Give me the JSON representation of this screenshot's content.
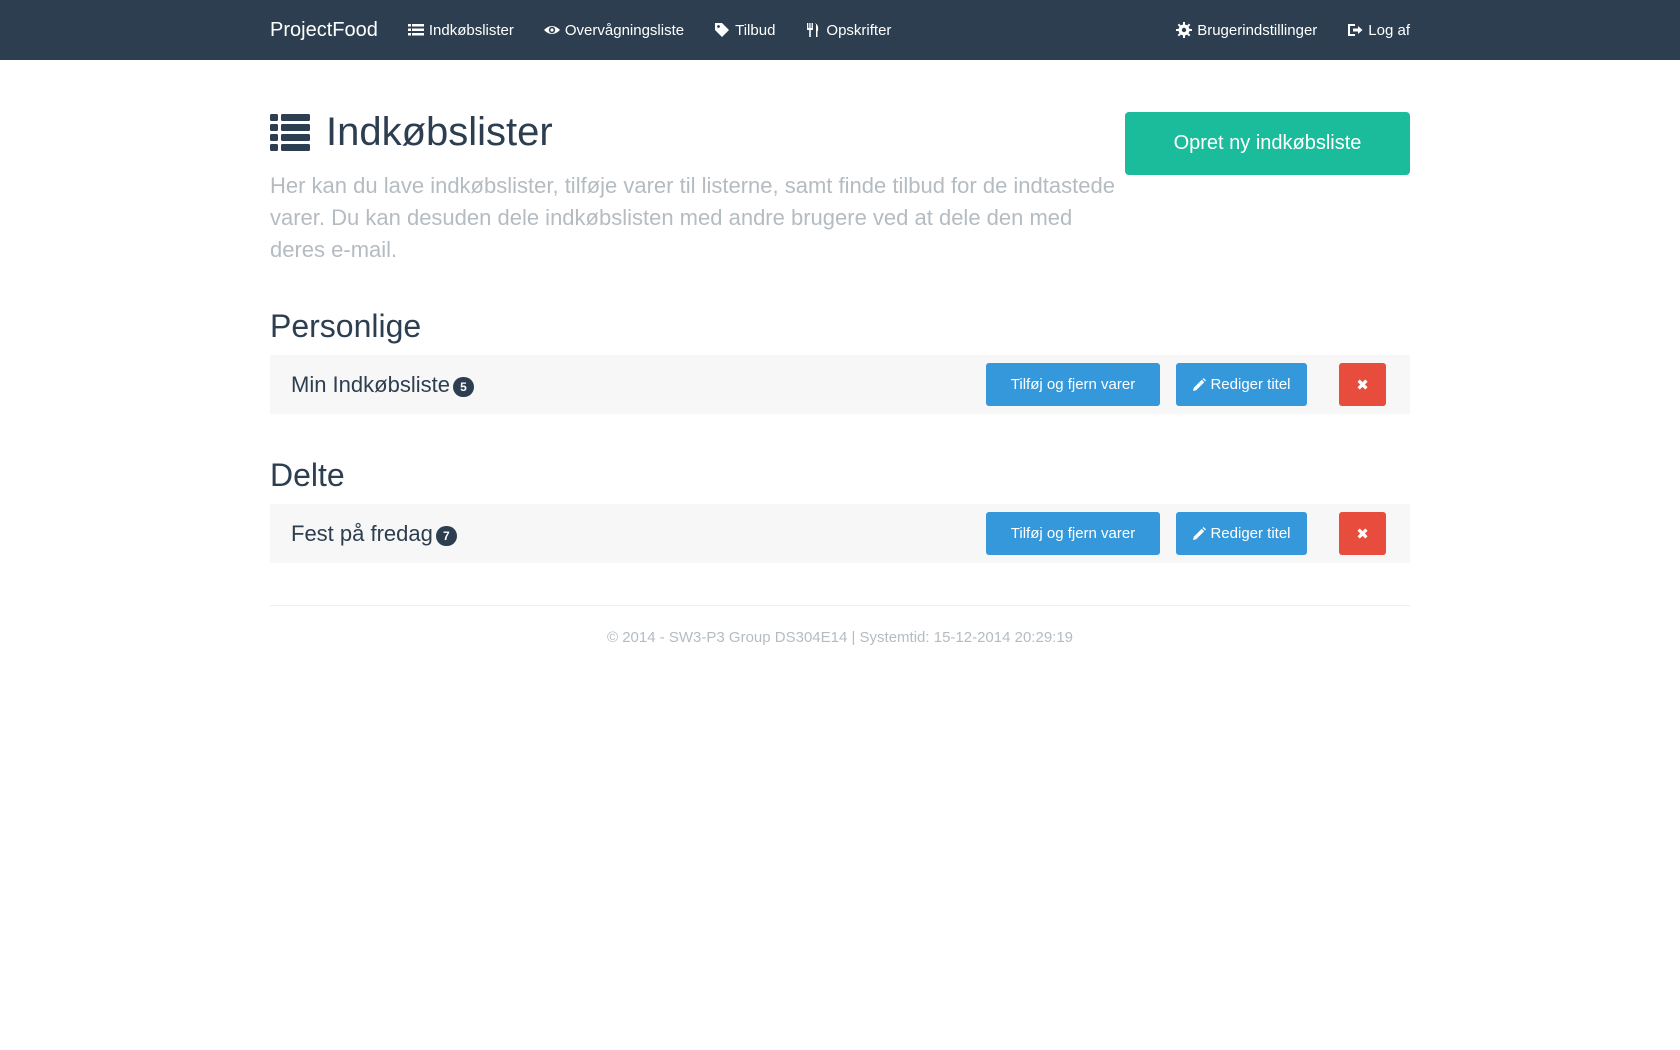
{
  "navbar": {
    "brand": "ProjectFood",
    "links": [
      {
        "label": "Indkøbslister",
        "icon": "list-icon"
      },
      {
        "label": "Overvågningsliste",
        "icon": "eye-icon"
      },
      {
        "label": "Tilbud",
        "icon": "tags-icon"
      },
      {
        "label": "Opskrifter",
        "icon": "cutlery-icon"
      }
    ],
    "right_links": [
      {
        "label": "Brugerindstillinger",
        "icon": "gear-icon"
      },
      {
        "label": "Log af",
        "icon": "logout-icon"
      }
    ]
  },
  "header": {
    "title": "Indkøbslister",
    "lead": "Her kan du lave indkøbslister, tilføje varer til listerne, samt finde tilbud for de indtastede varer. Du kan desuden dele indkøbslisten med andre brugere ved at dele den med deres e-mail.",
    "create_button": "Opret ny indkøbsliste"
  },
  "sections": [
    {
      "title": "Personlige",
      "lists": [
        {
          "name": "Min Indkøbsliste",
          "count": "5",
          "add_label": "Tilføj og fjern varer",
          "edit_label": "Rediger titel",
          "delete_label": "✖"
        }
      ]
    },
    {
      "title": "Delte",
      "lists": [
        {
          "name": "Fest på fredag",
          "count": "7",
          "add_label": "Tilføj og fjern varer",
          "edit_label": "Rediger titel",
          "delete_label": "✖"
        }
      ]
    }
  ],
  "footer": {
    "text": "© 2014 - SW3-P3 Group DS304E14 | Systemtid: 15-12-2014 20:29:19"
  },
  "colors": {
    "navbar": "#2c3e50",
    "primary_green": "#1abc9c",
    "info_blue": "#3498db",
    "danger_red": "#e74c3c",
    "muted": "#b4bcc2",
    "row_bg": "#f7f7f7"
  }
}
